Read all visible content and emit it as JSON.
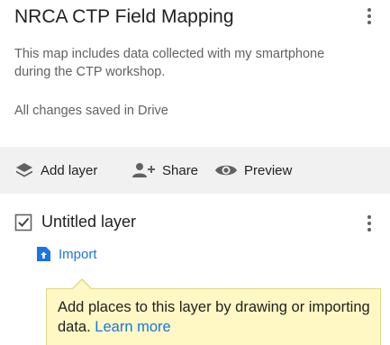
{
  "map": {
    "title": "NRCA CTP Field Mapping",
    "description": "This map includes data collected with my smartphone during the CTP workshop.",
    "save_status": "All changes saved in Drive"
  },
  "toolbar": {
    "add_layer_label": "Add layer",
    "share_label": "Share",
    "preview_label": "Preview"
  },
  "layer": {
    "name": "Untitled layer",
    "checked": true,
    "import_label": "Import"
  },
  "tooltip": {
    "text": "Add places to this layer by drawing or importing data.",
    "link_label": "Learn more"
  },
  "colors": {
    "link": "#1a73e8",
    "toolbar_bg": "#f1f1f1",
    "tooltip_bg": "#fff8c4",
    "icon_gray": "#616161"
  },
  "icons": {
    "map_menu": "more-vert-icon",
    "add_layer": "layers-plus-icon",
    "share": "person-add-icon",
    "preview": "eye-icon",
    "layer_checkbox": "checkbox-checked-icon",
    "layer_menu": "more-vert-icon",
    "import": "file-upload-icon"
  }
}
